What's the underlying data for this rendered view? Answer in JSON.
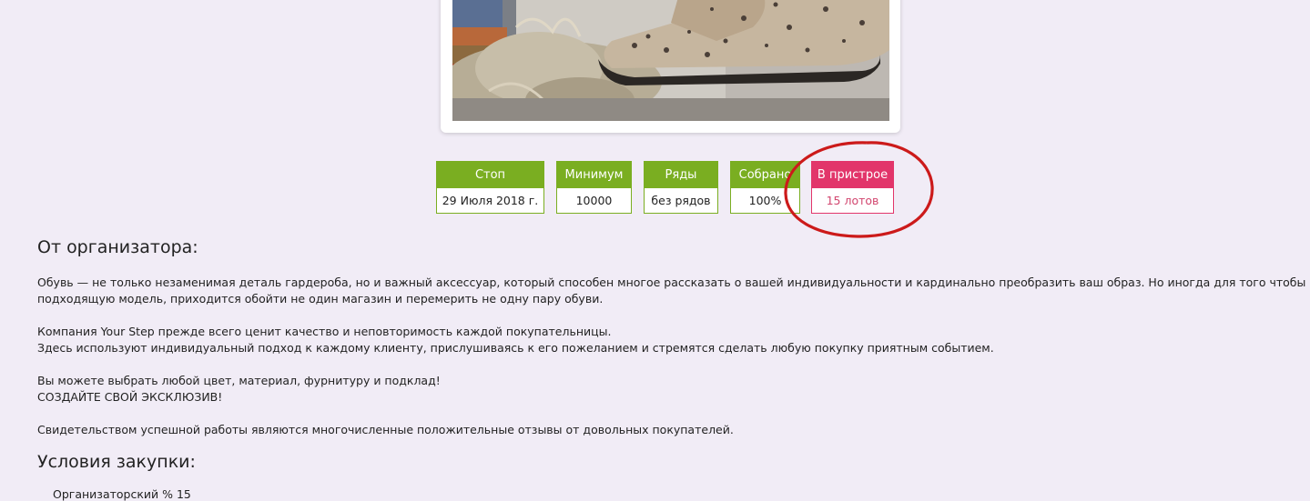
{
  "stats": [
    {
      "label": "Стоп",
      "value": "29 Июля 2018 г."
    },
    {
      "label": "Минимум",
      "value": "10000"
    },
    {
      "label": "Ряды",
      "value": "без рядов"
    },
    {
      "label": "Собрано",
      "value": "100%"
    },
    {
      "label": "В пристрое",
      "value": "15 лотов"
    }
  ],
  "organizer": {
    "title": "От организатора:",
    "paragraph1": {
      "line1": "Обувь — не только незаменимая деталь гардероба, но и важный аксессуар, который способен многое рассказать о вашей индивидуальности и кардинально преобразить ваш образ. Но иногда для того чтобы найти",
      "line2": "подходящую модель, приходится обойти не один магазин и перемерить не одну пару обуви."
    },
    "paragraph2": {
      "line1": "Компания Your Step прежде всего ценит качество и неповторимость каждой покупательницы.",
      "line2": "Здесь используют индивидуальный подход к каждому клиенту, прислушиваясь к его пожеланием и стремятся сделать любую покупку приятным событием."
    },
    "paragraph3": {
      "line1": "Вы можете выбрать любой цвет, материал, фурнитуру и подклад!",
      "line2": "СОЗДАЙТЕ СВОЙ ЭКСКЛЮЗИВ!"
    },
    "paragraph4": "Свидетельством успешной работы являются многочисленные положительные отзывы от довольных покупателей."
  },
  "conditions": {
    "title": "Условия закупки:",
    "first_item": "Организаторский % 15"
  },
  "colors": {
    "green": "#7aae21",
    "pink": "#e2356a",
    "annotation_red": "#cc1a1a",
    "background": "#f1ecf6"
  }
}
